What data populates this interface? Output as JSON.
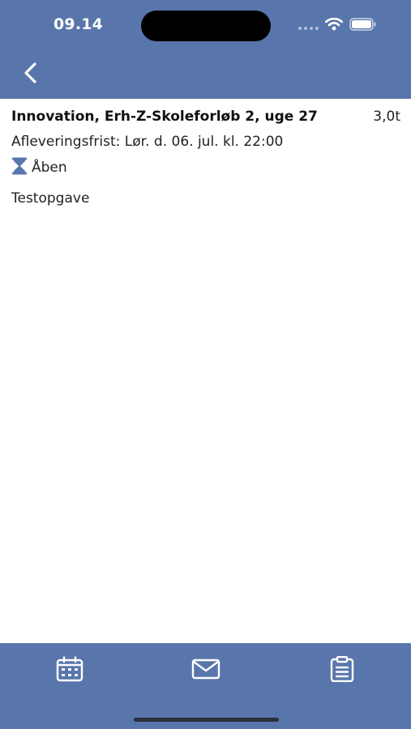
{
  "status_bar": {
    "time": "09.14"
  },
  "icons": {
    "back": "chevron-left-icon",
    "wifi": "wifi-icon",
    "battery": "battery-icon",
    "hourglass": "hourglass-icon",
    "calendar": "calendar-icon",
    "mail": "mail-icon",
    "clipboard": "clipboard-icon"
  },
  "assignment": {
    "title": "Innovation, Erh-Z-Skoleforløb 2, uge 27",
    "hours": "3,0t",
    "deadline": "Afleveringsfrist: Lør. d. 06. jul. kl. 22:00",
    "status": "Åben",
    "description": "Testopgave"
  },
  "colors": {
    "brand": "#5876ab",
    "background": "#ffffff",
    "text": "#222222"
  }
}
